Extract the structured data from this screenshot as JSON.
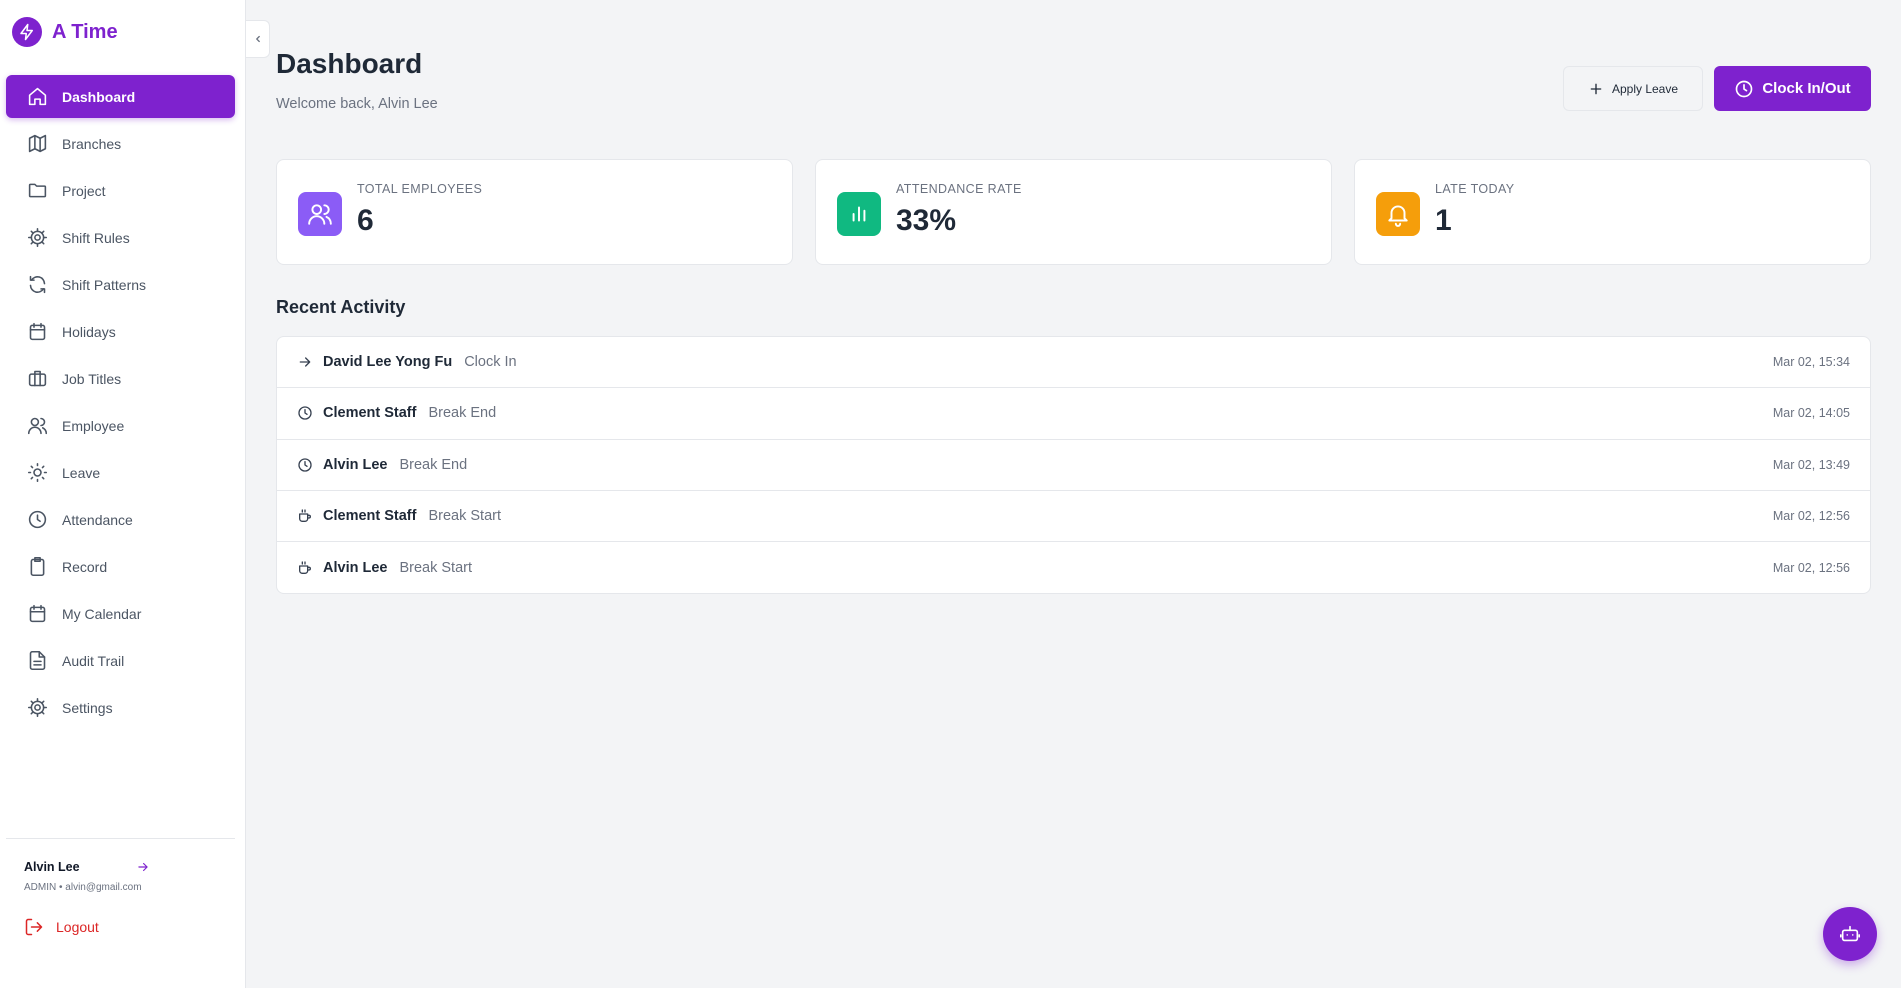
{
  "brand": {
    "name": "A Time"
  },
  "sidebar": {
    "items": [
      {
        "label": "Dashboard",
        "icon": "home-icon",
        "active": true
      },
      {
        "label": "Branches",
        "icon": "map-icon"
      },
      {
        "label": "Project",
        "icon": "folder-icon"
      },
      {
        "label": "Shift Rules",
        "icon": "gear-icon"
      },
      {
        "label": "Shift Patterns",
        "icon": "refresh-icon"
      },
      {
        "label": "Holidays",
        "icon": "calendar-icon"
      },
      {
        "label": "Job Titles",
        "icon": "briefcase-icon"
      },
      {
        "label": "Employee",
        "icon": "users-icon"
      },
      {
        "label": "Leave",
        "icon": "sun-icon"
      },
      {
        "label": "Attendance",
        "icon": "clock-icon"
      },
      {
        "label": "Record",
        "icon": "clipboard-icon"
      },
      {
        "label": "My Calendar",
        "icon": "calendar-icon"
      },
      {
        "label": "Audit Trail",
        "icon": "file-text-icon"
      },
      {
        "label": "Settings",
        "icon": "gear-icon"
      }
    ]
  },
  "user": {
    "name": "Alvin Lee",
    "meta": "ADMIN • alvin@gmail.com",
    "logout_label": "Logout"
  },
  "header": {
    "title": "Dashboard",
    "subtitle": "Welcome back, Alvin Lee",
    "apply_leave_label": "Apply Leave",
    "clock_label": "Clock In/Out"
  },
  "stats": [
    {
      "label": "TOTAL EMPLOYEES",
      "value": "6",
      "color": "#8b5cf6",
      "icon": "users-icon"
    },
    {
      "label": "ATTENDANCE RATE",
      "value": "33%",
      "color": "#10b981",
      "icon": "bar-chart-icon"
    },
    {
      "label": "LATE TODAY",
      "value": "1",
      "color": "#f59e0b",
      "icon": "bell-icon"
    }
  ],
  "activity": {
    "title": "Recent Activity",
    "rows": [
      {
        "name": "David Lee Yong Fu",
        "action": "Clock In",
        "time": "Mar 02, 15:34",
        "icon": "arrow-right-icon"
      },
      {
        "name": "Clement Staff",
        "action": "Break End",
        "time": "Mar 02, 14:05",
        "icon": "clock-icon"
      },
      {
        "name": "Alvin Lee",
        "action": "Break End",
        "time": "Mar 02, 13:49",
        "icon": "clock-icon"
      },
      {
        "name": "Clement Staff",
        "action": "Break Start",
        "time": "Mar 02, 12:56",
        "icon": "coffee-icon"
      },
      {
        "name": "Alvin Lee",
        "action": "Break Start",
        "time": "Mar 02, 12:56",
        "icon": "coffee-icon"
      }
    ]
  },
  "colors": {
    "accent": "#7e22ce",
    "danger": "#dc2626"
  }
}
